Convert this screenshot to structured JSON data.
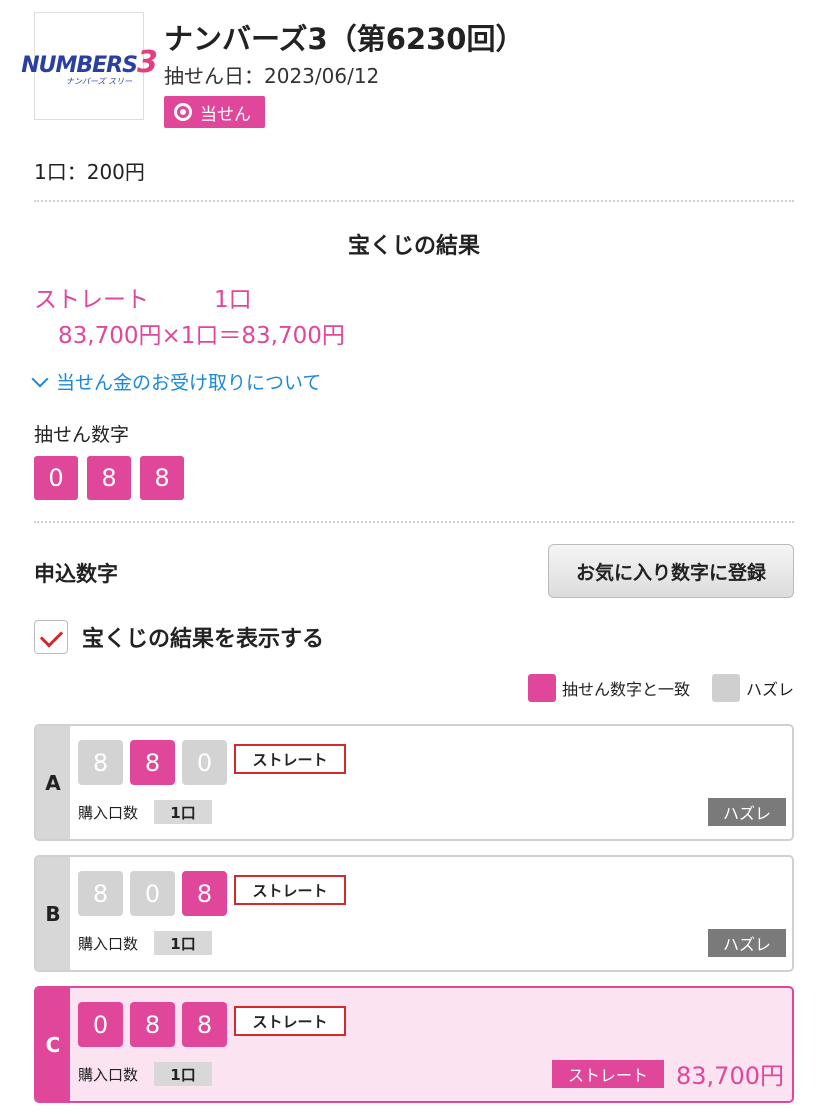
{
  "header": {
    "logo_text": "NUMBERS3",
    "logo_sub": "ナンバーズ スリー",
    "title": "ナンバーズ3（第6230回）",
    "draw_date": "抽せん日：2023/06/12",
    "badge": "当せん"
  },
  "unit_price": "1口：200円",
  "result": {
    "heading": "宝くじの結果",
    "type": "ストレート",
    "count": "1口",
    "calc": "83,700円×1口＝83,700円",
    "receive_link": "当せん金のお受け取りについて"
  },
  "draw": {
    "label": "抽せん数字",
    "digits": [
      "0",
      "8",
      "8"
    ]
  },
  "entry_section": {
    "title": "申込数字",
    "favorite_button": "お気に入り数字に登録",
    "show_result_label": "宝くじの結果を表示する",
    "show_result_checked": true,
    "legend_match": "抽せん数字と一致",
    "legend_miss": "ハズレ"
  },
  "entries": [
    {
      "letter": "A",
      "digits": [
        "8",
        "8",
        "0"
      ],
      "match": [
        false,
        true,
        false
      ],
      "type": "ストレート",
      "qty_label": "購入口数",
      "qty": "1口",
      "status": "ハズレ"
    },
    {
      "letter": "B",
      "digits": [
        "8",
        "0",
        "8"
      ],
      "match": [
        false,
        false,
        true
      ],
      "type": "ストレート",
      "qty_label": "購入口数",
      "qty": "1口",
      "status": "ハズレ"
    },
    {
      "letter": "C",
      "digits": [
        "0",
        "8",
        "8"
      ],
      "match": [
        true,
        true,
        true
      ],
      "type": "ストレート",
      "qty_label": "購入口数",
      "qty": "1口",
      "prize_type": "ストレート",
      "prize_amount": "83,700円"
    }
  ],
  "colors": {
    "accent_pink": "#e0479a",
    "link_blue": "#1a8ad6",
    "miss_gray": "#7a7a7a"
  }
}
